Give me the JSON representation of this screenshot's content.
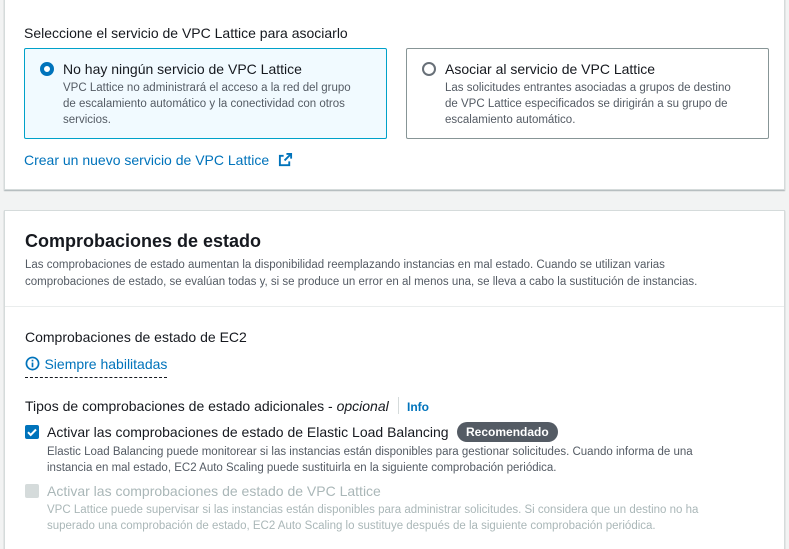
{
  "vpc_lattice": {
    "section_label": "Seleccione el servicio de VPC Lattice para asociarlo",
    "options": [
      {
        "label": "No hay ningún servicio de VPC Lattice",
        "description_lines": [
          "VPC Lattice no administrará el acceso a la red del grupo",
          "de escalamiento automático y la conectividad con otros",
          "servicios."
        ],
        "selected": true
      },
      {
        "label": "Asociar al servicio de VPC Lattice",
        "description_lines": [
          "Las solicitudes entrantes asociadas a grupos de destino",
          "de VPC Lattice especificados se dirigirán a su grupo de",
          "escalamiento automático."
        ],
        "selected": false
      }
    ],
    "create_link": "Crear un nuevo servicio de VPC Lattice",
    "create_link_icon": "external-link-icon"
  },
  "health_checks": {
    "title": "Comprobaciones de estado",
    "description_lines": [
      "Las comprobaciones de estado aumentan la disponibilidad reemplazando instancias en mal estado. Cuando se utilizan varias",
      "comprobaciones de estado, se evalúan todas y, si se produce un error en al menos una, se lleva a cabo la sustitución de instancias."
    ],
    "ec2_label": "Comprobaciones de estado de EC2",
    "ec2_status": "Siempre habilitadas",
    "ec2_status_icon": "info-icon",
    "additional_label": "Tipos de comprobaciones de estado adicionales - ",
    "additional_optional": "opcional",
    "info_link": "Info",
    "checks": [
      {
        "label": "Activar las comprobaciones de estado de Elastic Load Balancing",
        "badge": "Recomendado",
        "checked": true,
        "disabled": false,
        "description_lines": [
          "Elastic Load Balancing puede monitorear si las instancias están disponibles para gestionar solicitudes. Cuando informa de una",
          "instancia en mal estado, EC2 Auto Scaling puede sustituirla en la siguiente comprobación periódica."
        ]
      },
      {
        "label": "Activar las comprobaciones de estado de VPC Lattice",
        "checked": false,
        "disabled": true,
        "description_lines": [
          "VPC Lattice puede supervisar si las instancias están disponibles para administrar solicitudes. Si considera que un destino no ha",
          "superado una comprobación de estado, EC2 Auto Scaling lo sustituye después de la siguiente comprobación periódica."
        ]
      }
    ]
  },
  "colors": {
    "accent": "#0073bb",
    "selected_border": "#00a1c9",
    "selected_bg": "#f1faff",
    "badge_bg": "#545b64",
    "disabled": "#aab7b8"
  }
}
